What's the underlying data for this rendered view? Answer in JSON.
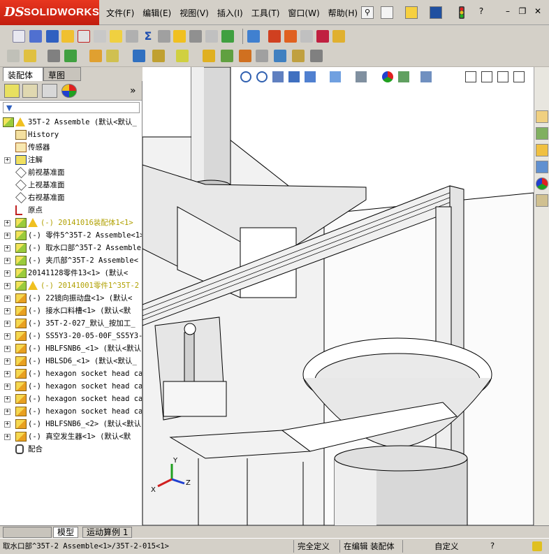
{
  "app": {
    "brand_ds": "DS",
    "brand_name": "SOLIDWORKS"
  },
  "menu": [
    {
      "label": "文件(F)"
    },
    {
      "label": "编辑(E)"
    },
    {
      "label": "视图(V)"
    },
    {
      "label": "插入(I)"
    },
    {
      "label": "工具(T)"
    },
    {
      "label": "窗口(W)"
    },
    {
      "label": "帮助(H)"
    }
  ],
  "window_controls": {
    "help": "?",
    "minimize": "–",
    "restore": "❐",
    "close": "✕"
  },
  "tabs": {
    "assembly": "装配体",
    "sketch": "草图"
  },
  "panel": {
    "expand_label": "»"
  },
  "tree": [
    {
      "label": "35T-2 Assemble  (默认<默认_",
      "kind": "root",
      "warn": true,
      "expand": "",
      "indent": 0
    },
    {
      "label": "History",
      "kind": "history",
      "expand": "",
      "indent": 1
    },
    {
      "label": "传感器",
      "kind": "sensor",
      "expand": "",
      "indent": 1
    },
    {
      "label": "注解",
      "kind": "annotation",
      "expand": "+",
      "indent": 1
    },
    {
      "label": "前视基准面",
      "kind": "plane",
      "expand": "",
      "indent": 1
    },
    {
      "label": "上视基准面",
      "kind": "plane",
      "expand": "",
      "indent": 1
    },
    {
      "label": "右视基准面",
      "kind": "plane",
      "expand": "",
      "indent": 1
    },
    {
      "label": "原点",
      "kind": "origin",
      "expand": "",
      "indent": 1
    },
    {
      "label": "(-) 20141016装配体1<1>",
      "kind": "assembly",
      "warn": true,
      "dim": true,
      "expand": "+",
      "indent": 1
    },
    {
      "label": "(-) 零件5^35T-2 Assemble<1>",
      "kind": "assembly",
      "expand": "+",
      "indent": 1
    },
    {
      "label": "(-) 取水口部^35T-2 Assemble",
      "kind": "assembly",
      "expand": "+",
      "indent": 1
    },
    {
      "label": "(-) 夹爪部^35T-2 Assemble<",
      "kind": "assembly",
      "expand": "+",
      "indent": 1
    },
    {
      "label": "20141128零件13<1> (默认<",
      "kind": "assembly",
      "expand": "+",
      "indent": 1
    },
    {
      "label": "(-) 20141001零件1^35T-2",
      "kind": "assembly",
      "warn": true,
      "dim": true,
      "expand": "+",
      "indent": 1
    },
    {
      "label": "(-) 22镜向振动盘<1> (默认<",
      "kind": "part",
      "expand": "+",
      "indent": 1
    },
    {
      "label": "(-) 接水口料槽<1> (默认<默",
      "kind": "part",
      "expand": "+",
      "indent": 1
    },
    {
      "label": "(-) 35T-2-027_默认_按加工_",
      "kind": "part",
      "expand": "+",
      "indent": 1
    },
    {
      "label": "(-) SS5Y3-20-05-00F_SS5Y3-",
      "kind": "part",
      "expand": "+",
      "indent": 1
    },
    {
      "label": "(-) HBLFSNB6_<1> (默认<默认",
      "kind": "part",
      "expand": "+",
      "indent": 1
    },
    {
      "label": "(-) HBLSD6_<1> (默认<默认_",
      "kind": "part",
      "expand": "+",
      "indent": 1
    },
    {
      "label": "(-) hexagon socket head cap",
      "kind": "part",
      "expand": "+",
      "indent": 1
    },
    {
      "label": "(-) hexagon socket head cap",
      "kind": "part",
      "expand": "+",
      "indent": 1
    },
    {
      "label": "(-) hexagon socket head cap",
      "kind": "part",
      "expand": "+",
      "indent": 1
    },
    {
      "label": "(-) hexagon socket head cap",
      "kind": "part",
      "expand": "+",
      "indent": 1
    },
    {
      "label": "(-) HBLFSNB6_<2> (默认<默认",
      "kind": "part",
      "expand": "+",
      "indent": 1
    },
    {
      "label": "(-) 真空发生器<1> (默认<默",
      "kind": "part",
      "expand": "+",
      "indent": 1
    },
    {
      "label": "配合",
      "kind": "mates",
      "expand": "",
      "indent": 1
    }
  ],
  "bottom_tabs": {
    "model": "模型",
    "motion": "运动算例 1"
  },
  "status": {
    "path": "取水口部^35T-2 Assemble<1>/35T-2-015<1>",
    "definition": "完全定义",
    "editing": "在编辑 装配体",
    "units": "自定义",
    "help": "?"
  },
  "triad": {
    "x": "X",
    "y": "Y",
    "z": "Z"
  },
  "colors": {
    "brand_red": "#d8281a",
    "panel_bg": "#d4d0c8",
    "warn": "#f0c020",
    "axis_x": "#d02020",
    "axis_y": "#20a020",
    "axis_z": "#2040d0"
  }
}
